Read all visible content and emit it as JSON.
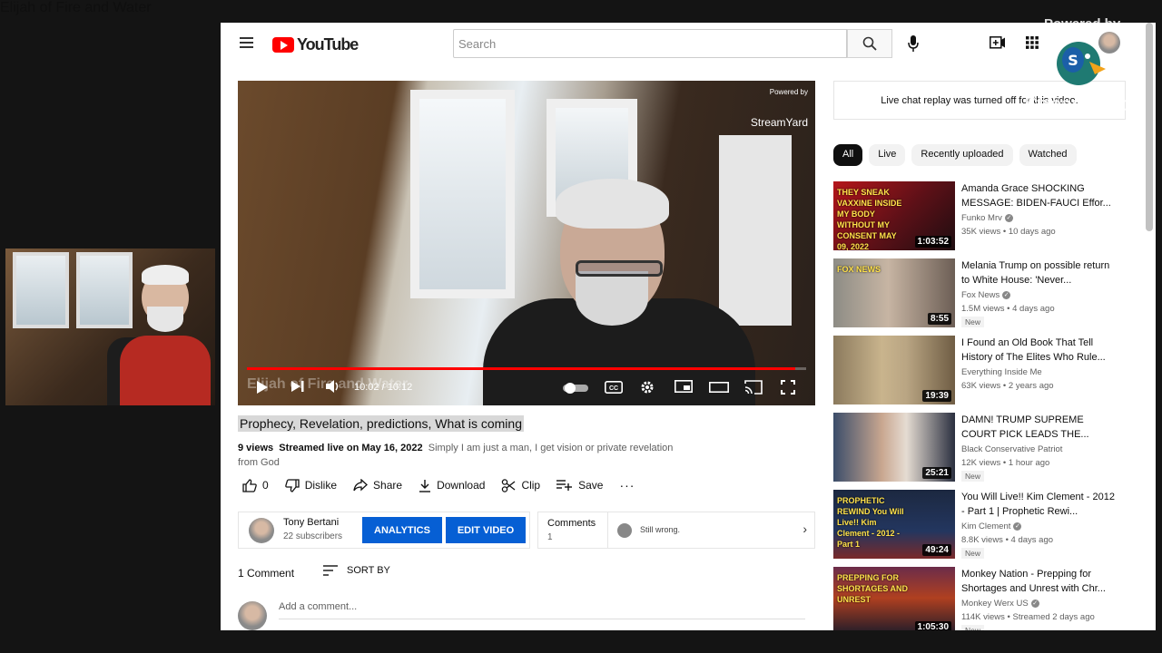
{
  "overlay": {
    "camera_name": "Elijah of Fire and Water",
    "watermark_top": "Powered by",
    "watermark_brand": "StreamYard"
  },
  "masthead": {
    "logo_text": "YouTube",
    "search_placeholder": "Search"
  },
  "player": {
    "watermark_small": "Powered by",
    "watermark_small_brand": "StreamYard",
    "overlay_title": "Elijah of Fire and Water",
    "time": "10:02 / 10:12",
    "progress": 0.98
  },
  "video": {
    "title": "Prophecy, Revelation, predictions, What is coming",
    "views": "9 views",
    "streamed": "Streamed live on May 16, 2022",
    "description": "Simply I am just a man, I get vision or private revelation from God"
  },
  "actions": {
    "like_count": "0",
    "dislike": "Dislike",
    "share": "Share",
    "download": "Download",
    "clip": "Clip",
    "save": "Save"
  },
  "channel": {
    "name": "Tony Bertani",
    "subscribers": "22 subscribers",
    "analytics": "ANALYTICS",
    "edit_video": "EDIT VIDEO"
  },
  "comments_box": {
    "label": "Comments",
    "count": "1",
    "preview": "Still wrong."
  },
  "comments": {
    "count_label": "1 Comment",
    "sort_label": "SORT BY",
    "add_placeholder": "Add a comment..."
  },
  "sidebar": {
    "chat_notice": "Live chat replay was turned off for this video.",
    "chips": [
      "All",
      "Live",
      "Recently uploaded",
      "Watched"
    ],
    "recs": [
      {
        "title": "Amanda Grace SHOCKING MESSAGE: BIDEN-FAUCI Effor...",
        "channel": "Funko Mrv",
        "verified": true,
        "stats": "35K views • 10 days ago",
        "duration": "1:03:52",
        "badge": "",
        "thumb_text": "THEY SNEAK VAXXINE INSIDE MY BODY WITHOUT MY CONSENT MAY 09, 2022"
      },
      {
        "title": "Melania Trump on possible return to White House: 'Never...",
        "channel": "Fox News",
        "verified": true,
        "stats": "1.5M views • 4 days ago",
        "duration": "8:55",
        "badge": "New",
        "thumb_text": "FOX NEWS"
      },
      {
        "title": "I Found an Old Book That Tell History of The Elites Who Rule...",
        "channel": "Everything Inside Me",
        "verified": false,
        "stats": "63K views • 2 years ago",
        "duration": "19:39",
        "badge": "",
        "thumb_text": ""
      },
      {
        "title": "DAMN! TRUMP SUPREME COURT PICK LEADS THE...",
        "channel": "Black Conservative Patriot",
        "verified": false,
        "stats": "12K views • 1 hour ago",
        "duration": "25:21",
        "badge": "New",
        "thumb_text": ""
      },
      {
        "title": "You Will Live!! Kim Clement - 2012 - Part 1 | Prophetic Rewi...",
        "channel": "Kim Clement",
        "verified": true,
        "stats": "8.8K views • 4 days ago",
        "duration": "49:24",
        "badge": "New",
        "thumb_text": "PROPHETIC REWIND You Will Live!! Kim Clement - 2012 - Part 1"
      },
      {
        "title": "Monkey Nation - Prepping for Shortages and Unrest with Chr...",
        "channel": "Monkey Werx US",
        "verified": true,
        "stats": "114K views • Streamed 2 days ago",
        "duration": "1:05:30",
        "badge": "New",
        "thumb_text": "PREPPING FOR SHORTAGES AND UNREST"
      }
    ]
  },
  "colors": {
    "youtube_red": "#ff0000",
    "button_blue": "#065fd4",
    "page_bg": "#141414"
  }
}
